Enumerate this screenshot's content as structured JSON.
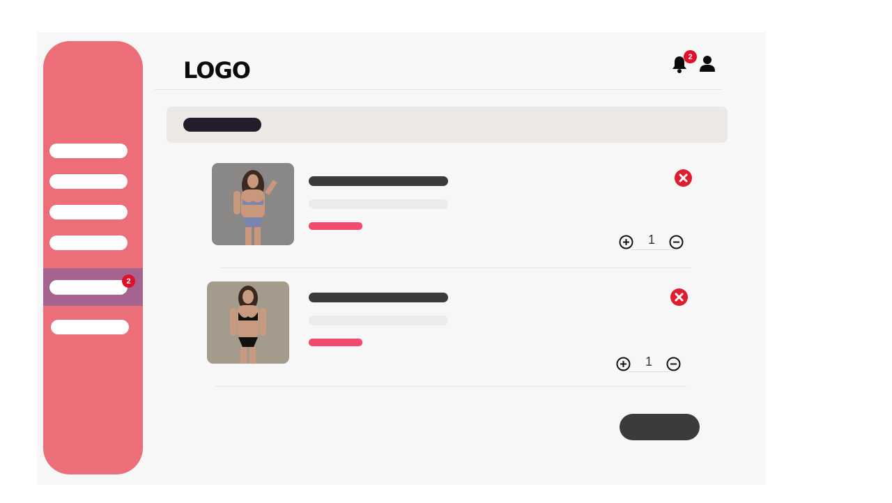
{
  "header": {
    "logo_text": "LOGO",
    "notification_count": "2"
  },
  "sidebar": {
    "items": [
      {
        "label": ""
      },
      {
        "label": ""
      },
      {
        "label": ""
      },
      {
        "label": ""
      },
      {
        "label": "",
        "active": true,
        "badge": "2"
      },
      {
        "label": ""
      }
    ]
  },
  "cart": {
    "items": [
      {
        "quantity": "1",
        "image": "woman-in-lavender-bikini-photo"
      },
      {
        "quantity": "1",
        "image": "woman-in-black-bikini-photo"
      }
    ]
  },
  "colors": {
    "sidebar": "#ec6e78",
    "sidebar_active": "#a5638f",
    "accent_pink": "#f14a6c",
    "badge_red": "#e0102a",
    "remove_red": "#df1d30",
    "dark": "#3b3b3b"
  },
  "icons": [
    "bell-icon",
    "user-icon",
    "remove-icon",
    "plus-icon",
    "minus-icon"
  ]
}
